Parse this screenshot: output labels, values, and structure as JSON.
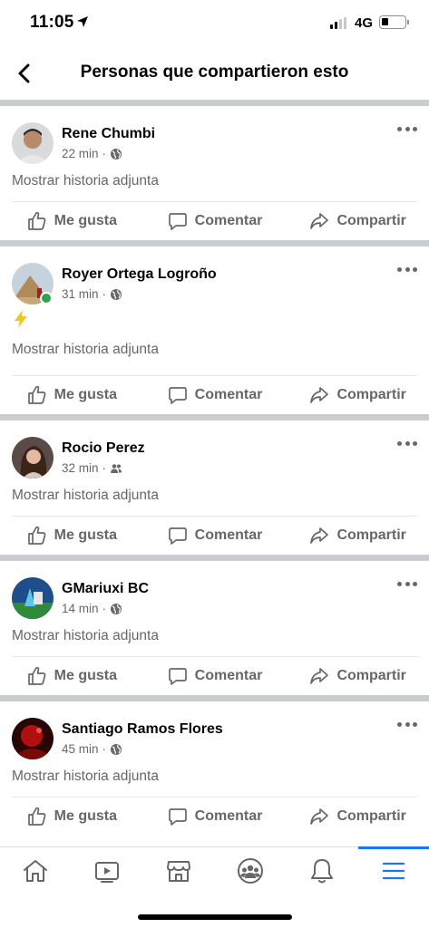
{
  "status_bar": {
    "time": "11:05",
    "network": "4G"
  },
  "header": {
    "title": "Personas que compartieron esto"
  },
  "posts": [
    {
      "author": "Rene Chumbi",
      "time": "22 min",
      "audience": "globe-icon",
      "attachment": "Mostrar historia adjunta",
      "online": false,
      "emoji": false
    },
    {
      "author": "Royer Ortega Logroño",
      "time": "31 min",
      "audience": "globe-icon",
      "attachment": "Mostrar historia adjunta",
      "online": true,
      "emoji": true
    },
    {
      "author": "Rocio Perez",
      "time": "32 min",
      "audience": "friends-icon",
      "attachment": "Mostrar historia adjunta",
      "online": false,
      "emoji": false
    },
    {
      "author": "GMariuxi BC",
      "time": "14 min",
      "audience": "globe-icon",
      "attachment": "Mostrar historia adjunta",
      "online": false,
      "emoji": false
    },
    {
      "author": "Santiago Ramos Flores",
      "time": "45 min",
      "audience": "globe-icon",
      "attachment": "Mostrar historia adjunta",
      "online": false,
      "emoji": false
    }
  ],
  "actions": {
    "like": "Me gusta",
    "comment": "Comentar",
    "share": "Compartir"
  },
  "tabs": [
    {
      "name": "home-icon",
      "active": false
    },
    {
      "name": "watch-icon",
      "active": false
    },
    {
      "name": "marketplace-icon",
      "active": false
    },
    {
      "name": "groups-icon",
      "active": false
    },
    {
      "name": "notifications-icon",
      "active": false
    },
    {
      "name": "menu-icon",
      "active": true
    }
  ],
  "colors": {
    "accent": "#1877f2",
    "secondary_text": "#65676b",
    "divider": "#c9ccd1",
    "online": "#31a24c"
  }
}
